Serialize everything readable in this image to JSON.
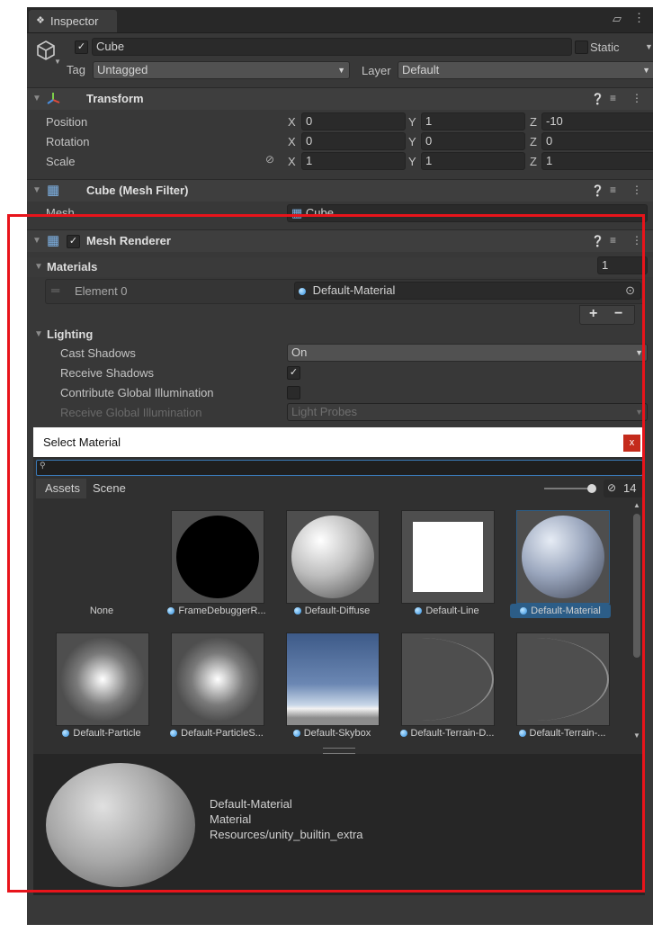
{
  "inspector": {
    "tab_title": "Inspector",
    "object": {
      "name": "Cube",
      "static_label": "Static",
      "tag_label": "Tag",
      "tag_value": "Untagged",
      "layer_label": "Layer",
      "layer_value": "Default"
    }
  },
  "transform": {
    "title": "Transform",
    "rows": [
      {
        "label": "Position",
        "x": "0",
        "y": "1",
        "z": "-10"
      },
      {
        "label": "Rotation",
        "x": "0",
        "y": "0",
        "z": "0"
      },
      {
        "label": "Scale",
        "x": "1",
        "y": "1",
        "z": "1"
      }
    ],
    "axis": {
      "x": "X",
      "y": "Y",
      "z": "Z"
    }
  },
  "mesh_filter": {
    "title": "Cube (Mesh Filter)",
    "mesh_label": "Mesh",
    "mesh_value": "Cube"
  },
  "mesh_renderer": {
    "title": "Mesh Renderer",
    "materials_label": "Materials",
    "materials_count": "1",
    "element_label": "Element 0",
    "element_value": "Default-Material",
    "add": "+",
    "remove": "−",
    "lighting_label": "Lighting",
    "cast_shadows_label": "Cast Shadows",
    "cast_shadows_value": "On",
    "receive_shadows_label": "Receive Shadows",
    "contribute_gi_label": "Contribute Global Illumination",
    "receive_gi_label": "Receive Global Illumination",
    "receive_gi_value": "Light Probes"
  },
  "picker": {
    "title": "Select Material",
    "close": "x",
    "search_value": "",
    "tabs": [
      "Assets",
      "Scene"
    ],
    "hidden_count": "14",
    "items": [
      {
        "label": "None"
      },
      {
        "label": "FrameDebuggerR..."
      },
      {
        "label": "Default-Diffuse"
      },
      {
        "label": "Default-Line"
      },
      {
        "label": "Default-Material"
      },
      {
        "label": "Default-Particle"
      },
      {
        "label": "Default-ParticleS..."
      },
      {
        "label": "Default-Skybox"
      },
      {
        "label": "Default-Terrain-D..."
      },
      {
        "label": "Default-Terrain-..."
      }
    ],
    "preview": {
      "name": "Default-Material",
      "type": "Material",
      "path": "Resources/unity_builtin_extra"
    }
  },
  "colors": {
    "selection_highlight": "#e8141b",
    "selected_item": "#2c5d87",
    "panel": "#383838"
  }
}
